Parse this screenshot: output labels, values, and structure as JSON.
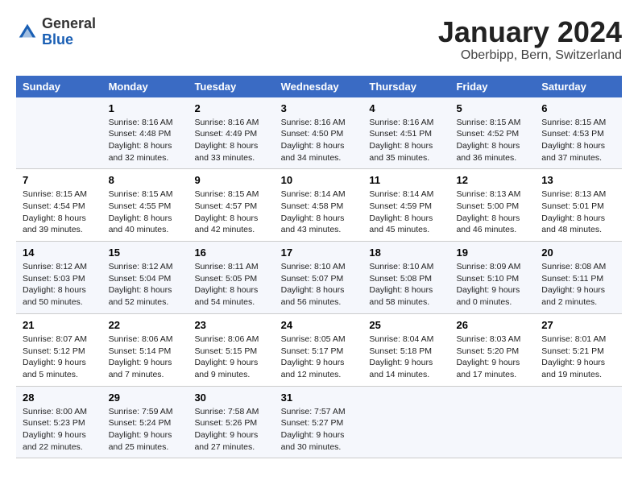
{
  "logo": {
    "general": "General",
    "blue": "Blue"
  },
  "title": "January 2024",
  "subtitle": "Oberbipp, Bern, Switzerland",
  "days_of_week": [
    "Sunday",
    "Monday",
    "Tuesday",
    "Wednesday",
    "Thursday",
    "Friday",
    "Saturday"
  ],
  "weeks": [
    [
      {
        "num": "",
        "sunrise": "",
        "sunset": "",
        "daylight": ""
      },
      {
        "num": "1",
        "sunrise": "Sunrise: 8:16 AM",
        "sunset": "Sunset: 4:48 PM",
        "daylight": "Daylight: 8 hours and 32 minutes."
      },
      {
        "num": "2",
        "sunrise": "Sunrise: 8:16 AM",
        "sunset": "Sunset: 4:49 PM",
        "daylight": "Daylight: 8 hours and 33 minutes."
      },
      {
        "num": "3",
        "sunrise": "Sunrise: 8:16 AM",
        "sunset": "Sunset: 4:50 PM",
        "daylight": "Daylight: 8 hours and 34 minutes."
      },
      {
        "num": "4",
        "sunrise": "Sunrise: 8:16 AM",
        "sunset": "Sunset: 4:51 PM",
        "daylight": "Daylight: 8 hours and 35 minutes."
      },
      {
        "num": "5",
        "sunrise": "Sunrise: 8:15 AM",
        "sunset": "Sunset: 4:52 PM",
        "daylight": "Daylight: 8 hours and 36 minutes."
      },
      {
        "num": "6",
        "sunrise": "Sunrise: 8:15 AM",
        "sunset": "Sunset: 4:53 PM",
        "daylight": "Daylight: 8 hours and 37 minutes."
      }
    ],
    [
      {
        "num": "7",
        "sunrise": "Sunrise: 8:15 AM",
        "sunset": "Sunset: 4:54 PM",
        "daylight": "Daylight: 8 hours and 39 minutes."
      },
      {
        "num": "8",
        "sunrise": "Sunrise: 8:15 AM",
        "sunset": "Sunset: 4:55 PM",
        "daylight": "Daylight: 8 hours and 40 minutes."
      },
      {
        "num": "9",
        "sunrise": "Sunrise: 8:15 AM",
        "sunset": "Sunset: 4:57 PM",
        "daylight": "Daylight: 8 hours and 42 minutes."
      },
      {
        "num": "10",
        "sunrise": "Sunrise: 8:14 AM",
        "sunset": "Sunset: 4:58 PM",
        "daylight": "Daylight: 8 hours and 43 minutes."
      },
      {
        "num": "11",
        "sunrise": "Sunrise: 8:14 AM",
        "sunset": "Sunset: 4:59 PM",
        "daylight": "Daylight: 8 hours and 45 minutes."
      },
      {
        "num": "12",
        "sunrise": "Sunrise: 8:13 AM",
        "sunset": "Sunset: 5:00 PM",
        "daylight": "Daylight: 8 hours and 46 minutes."
      },
      {
        "num": "13",
        "sunrise": "Sunrise: 8:13 AM",
        "sunset": "Sunset: 5:01 PM",
        "daylight": "Daylight: 8 hours and 48 minutes."
      }
    ],
    [
      {
        "num": "14",
        "sunrise": "Sunrise: 8:12 AM",
        "sunset": "Sunset: 5:03 PM",
        "daylight": "Daylight: 8 hours and 50 minutes."
      },
      {
        "num": "15",
        "sunrise": "Sunrise: 8:12 AM",
        "sunset": "Sunset: 5:04 PM",
        "daylight": "Daylight: 8 hours and 52 minutes."
      },
      {
        "num": "16",
        "sunrise": "Sunrise: 8:11 AM",
        "sunset": "Sunset: 5:05 PM",
        "daylight": "Daylight: 8 hours and 54 minutes."
      },
      {
        "num": "17",
        "sunrise": "Sunrise: 8:10 AM",
        "sunset": "Sunset: 5:07 PM",
        "daylight": "Daylight: 8 hours and 56 minutes."
      },
      {
        "num": "18",
        "sunrise": "Sunrise: 8:10 AM",
        "sunset": "Sunset: 5:08 PM",
        "daylight": "Daylight: 8 hours and 58 minutes."
      },
      {
        "num": "19",
        "sunrise": "Sunrise: 8:09 AM",
        "sunset": "Sunset: 5:10 PM",
        "daylight": "Daylight: 9 hours and 0 minutes."
      },
      {
        "num": "20",
        "sunrise": "Sunrise: 8:08 AM",
        "sunset": "Sunset: 5:11 PM",
        "daylight": "Daylight: 9 hours and 2 minutes."
      }
    ],
    [
      {
        "num": "21",
        "sunrise": "Sunrise: 8:07 AM",
        "sunset": "Sunset: 5:12 PM",
        "daylight": "Daylight: 9 hours and 5 minutes."
      },
      {
        "num": "22",
        "sunrise": "Sunrise: 8:06 AM",
        "sunset": "Sunset: 5:14 PM",
        "daylight": "Daylight: 9 hours and 7 minutes."
      },
      {
        "num": "23",
        "sunrise": "Sunrise: 8:06 AM",
        "sunset": "Sunset: 5:15 PM",
        "daylight": "Daylight: 9 hours and 9 minutes."
      },
      {
        "num": "24",
        "sunrise": "Sunrise: 8:05 AM",
        "sunset": "Sunset: 5:17 PM",
        "daylight": "Daylight: 9 hours and 12 minutes."
      },
      {
        "num": "25",
        "sunrise": "Sunrise: 8:04 AM",
        "sunset": "Sunset: 5:18 PM",
        "daylight": "Daylight: 9 hours and 14 minutes."
      },
      {
        "num": "26",
        "sunrise": "Sunrise: 8:03 AM",
        "sunset": "Sunset: 5:20 PM",
        "daylight": "Daylight: 9 hours and 17 minutes."
      },
      {
        "num": "27",
        "sunrise": "Sunrise: 8:01 AM",
        "sunset": "Sunset: 5:21 PM",
        "daylight": "Daylight: 9 hours and 19 minutes."
      }
    ],
    [
      {
        "num": "28",
        "sunrise": "Sunrise: 8:00 AM",
        "sunset": "Sunset: 5:23 PM",
        "daylight": "Daylight: 9 hours and 22 minutes."
      },
      {
        "num": "29",
        "sunrise": "Sunrise: 7:59 AM",
        "sunset": "Sunset: 5:24 PM",
        "daylight": "Daylight: 9 hours and 25 minutes."
      },
      {
        "num": "30",
        "sunrise": "Sunrise: 7:58 AM",
        "sunset": "Sunset: 5:26 PM",
        "daylight": "Daylight: 9 hours and 27 minutes."
      },
      {
        "num": "31",
        "sunrise": "Sunrise: 7:57 AM",
        "sunset": "Sunset: 5:27 PM",
        "daylight": "Daylight: 9 hours and 30 minutes."
      },
      {
        "num": "",
        "sunrise": "",
        "sunset": "",
        "daylight": ""
      },
      {
        "num": "",
        "sunrise": "",
        "sunset": "",
        "daylight": ""
      },
      {
        "num": "",
        "sunrise": "",
        "sunset": "",
        "daylight": ""
      }
    ]
  ]
}
